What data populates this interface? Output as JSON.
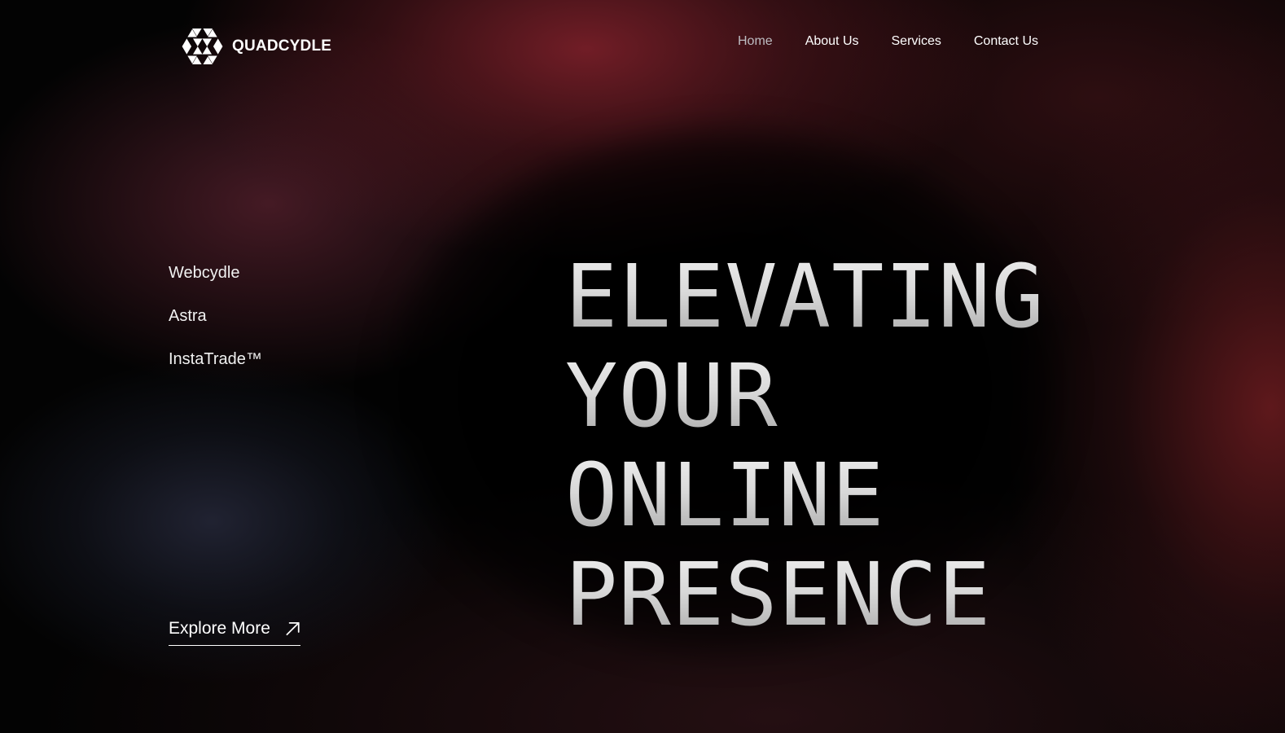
{
  "brand": {
    "name": "QUADCYDLE",
    "logo_icon": "hexagon-triangles-logo-icon"
  },
  "nav": {
    "items": [
      {
        "label": "Home",
        "active": true
      },
      {
        "label": "About Us",
        "active": false
      },
      {
        "label": "Services",
        "active": false
      },
      {
        "label": "Contact Us",
        "active": false
      }
    ]
  },
  "products": {
    "items": [
      {
        "label": "Webcydle"
      },
      {
        "label": "Astra"
      },
      {
        "label": "InstaTrade™"
      }
    ]
  },
  "hero": {
    "lines": [
      "ELEVATING",
      "YOUR",
      "ONLINE",
      "PRESENCE"
    ]
  },
  "cta": {
    "label": "Explore More",
    "icon": "arrow-up-right-icon"
  },
  "colors": {
    "background": "#030303",
    "accent_red": "#7d202a",
    "nav_active": "#bdbdc2",
    "text": "#ffffff"
  }
}
